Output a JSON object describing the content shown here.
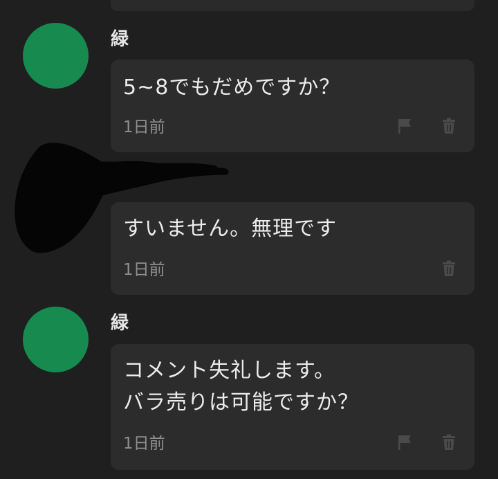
{
  "comments": [
    {
      "username": "緑",
      "text": "5~8でもだめですか？",
      "time": "1日前",
      "icons": [
        "flag-icon",
        "trash-icon"
      ]
    },
    {
      "username": "",
      "text": "すいません。無理です",
      "time": "1日前",
      "icons": [
        "trash-icon"
      ]
    },
    {
      "username": "緑",
      "text": "コメント失礼します。\nバラ売りは可能ですか？",
      "time": "1日前",
      "icons": [
        "flag-icon",
        "trash-icon"
      ]
    }
  ],
  "colors": {
    "background": "#1f1f1f",
    "bubble": "#2c2c2c",
    "avatar": "#168a4f",
    "text": "#ececec",
    "muted": "#8f8f8f",
    "icon": "#4a4a4a"
  }
}
